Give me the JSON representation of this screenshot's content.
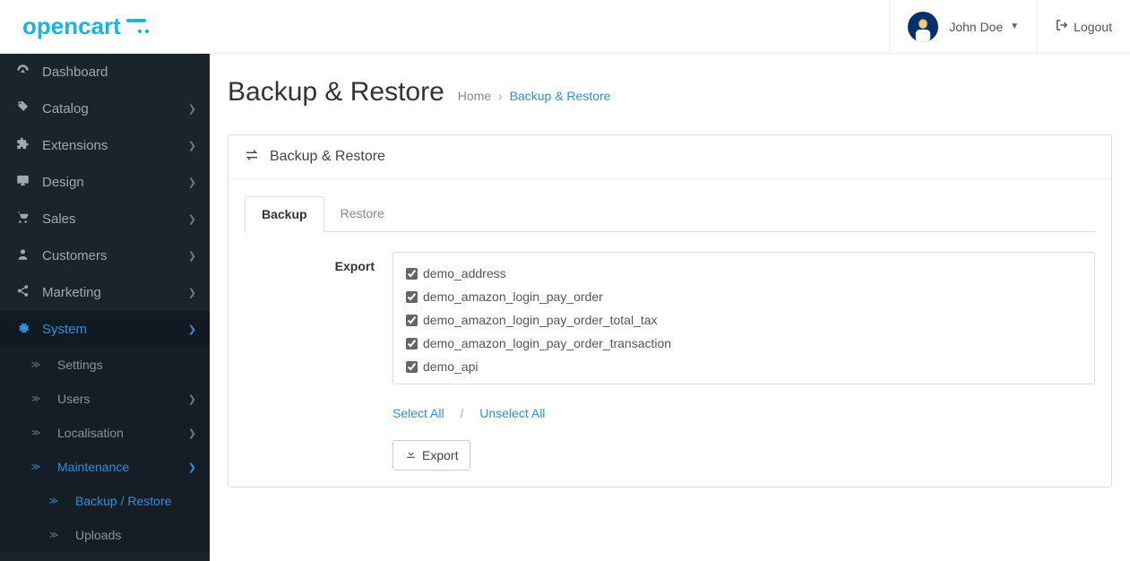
{
  "brand": "opencart",
  "user": {
    "name": "John Doe"
  },
  "logout_label": "Logout",
  "sidebar": {
    "items": [
      {
        "label": "Dashboard"
      },
      {
        "label": "Catalog"
      },
      {
        "label": "Extensions"
      },
      {
        "label": "Design"
      },
      {
        "label": "Sales"
      },
      {
        "label": "Customers"
      },
      {
        "label": "Marketing"
      },
      {
        "label": "System"
      }
    ],
    "system_sub": [
      {
        "label": "Settings"
      },
      {
        "label": "Users"
      },
      {
        "label": "Localisation"
      },
      {
        "label": "Maintenance"
      }
    ],
    "maintenance_sub": [
      {
        "label": "Backup / Restore"
      },
      {
        "label": "Uploads"
      }
    ]
  },
  "page": {
    "title": "Backup & Restore",
    "breadcrumb_home": "Home",
    "breadcrumb_current": "Backup & Restore"
  },
  "panel": {
    "title": "Backup & Restore",
    "tabs": [
      {
        "label": "Backup"
      },
      {
        "label": "Restore"
      }
    ],
    "export_label": "Export",
    "select_all": "Select All",
    "unselect_all": "Unselect All",
    "export_button": "Export",
    "tables": [
      "demo_address",
      "demo_amazon_login_pay_order",
      "demo_amazon_login_pay_order_total_tax",
      "demo_amazon_login_pay_order_transaction",
      "demo_api"
    ]
  }
}
